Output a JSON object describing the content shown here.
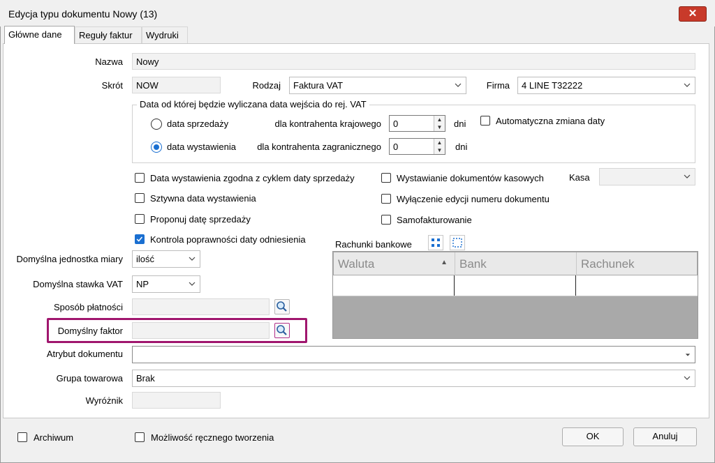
{
  "window": {
    "title": "Edycja typu dokumentu  Nowy (13)",
    "close_glyph": "✕"
  },
  "tabs": [
    {
      "label": "Główne dane",
      "active": true
    },
    {
      "label": "Reguły faktur",
      "active": false
    },
    {
      "label": "Wydruki",
      "active": false
    }
  ],
  "form": {
    "name_label": "Nazwa",
    "name_value": "Nowy",
    "short_label": "Skrót",
    "short_value": "NOW",
    "type_label": "Rodzaj",
    "type_value": "Faktura VAT",
    "company_label": "Firma",
    "company_value": "4 LINE T32222",
    "date_group": {
      "legend": "Data od której będzie wyliczana data wejścia do rej. VAT",
      "radio_sale": "data sprzedaży",
      "radio_issue": "data wystawienia",
      "selected": "data wystawienia",
      "domestic_label": "dla kontrahenta krajowego",
      "domestic_value": "0",
      "foreign_label": "dla kontrahenta zagranicznego",
      "foreign_value": "0",
      "days_unit": "dni",
      "auto_change_label": "Automatyczna zmiana daty",
      "auto_change_checked": false
    },
    "checkboxes_left": [
      {
        "label": "Data wystawienia zgodna z cyklem daty sprzedaży",
        "checked": false
      },
      {
        "label": "Sztywna data wystawienia",
        "checked": false
      },
      {
        "label": "Proponuj datę sprzedaży",
        "checked": false
      },
      {
        "label": "Kontrola poprawności daty odniesienia",
        "checked": true
      }
    ],
    "checkboxes_right": [
      {
        "label": "Wystawianie dokumentów kasowych",
        "checked": false
      },
      {
        "label": "Wyłączenie edycji numeru dokumentu",
        "checked": false
      },
      {
        "label": "Samofakturowanie",
        "checked": false
      }
    ],
    "cash_label": "Kasa",
    "cash_value": "",
    "unit_label": "Domyślna jednostka miary",
    "unit_value": "ilość",
    "vat_label": "Domyślna stawka VAT",
    "vat_value": "NP",
    "payment_label": "Sposób płatności",
    "payment_value": "",
    "factor_label": "Domyślny faktor",
    "factor_value": "",
    "attribute_label": "Atrybut dokumentu",
    "attribute_value": "",
    "group_label": "Grupa towarowa",
    "group_value": "Brak",
    "marker_label": "Wyróżnik",
    "marker_value": ""
  },
  "bank": {
    "title": "Rachunki bankowe",
    "columns": [
      "Waluta",
      "Bank",
      "Rachunek"
    ],
    "sort_glyph": "▲",
    "rows": [
      [
        "",
        "",
        ""
      ]
    ]
  },
  "footer": {
    "archive_label": "Archiwum",
    "archive_checked": false,
    "manual_label": "Możliwość ręcznego tworzenia",
    "manual_checked": false,
    "ok_label": "OK",
    "cancel_label": "Anuluj"
  },
  "colors": {
    "accent": "#1a6fd1",
    "highlight": "#a0166e",
    "close": "#c83a2a"
  }
}
